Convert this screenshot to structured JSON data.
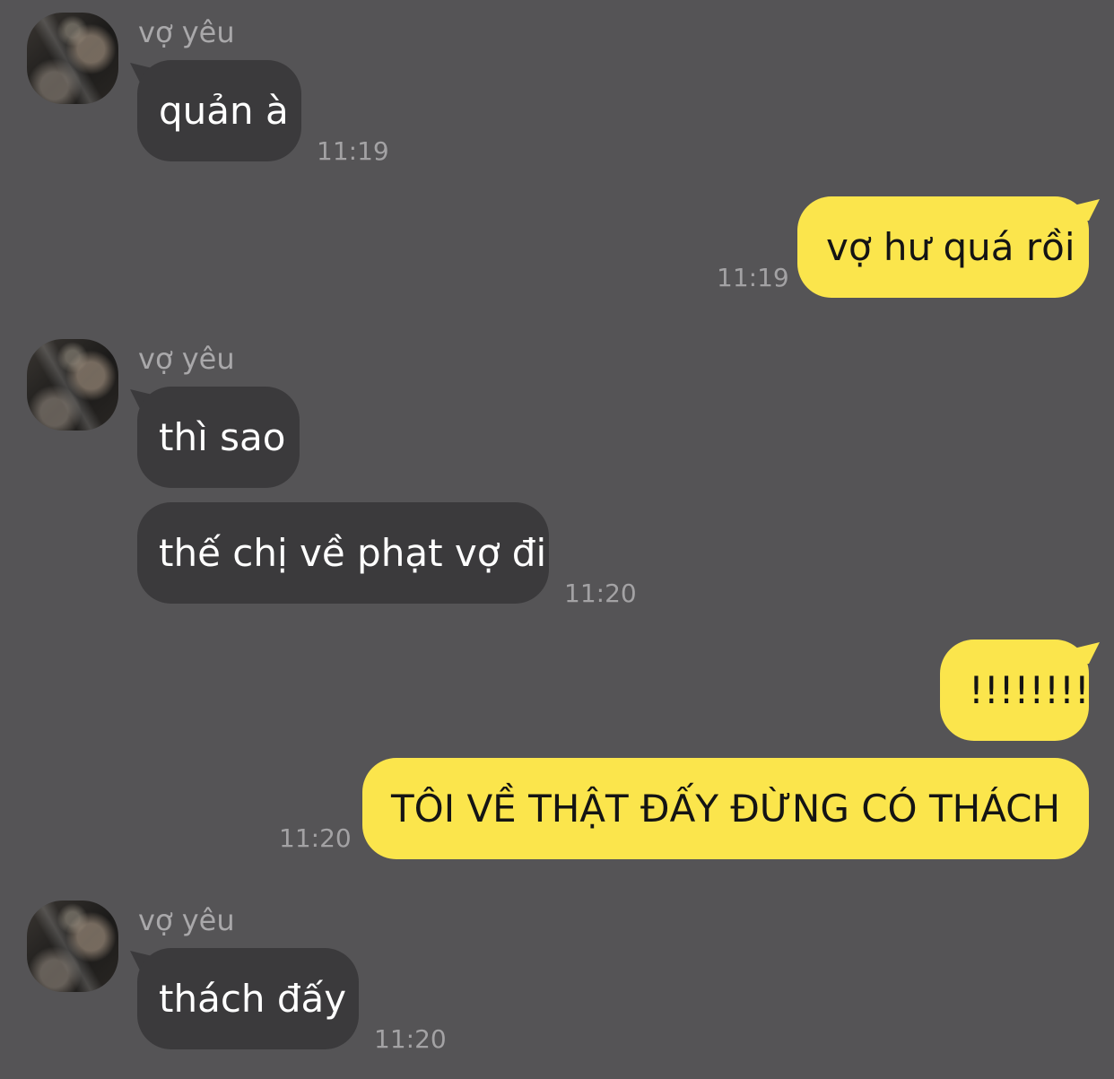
{
  "colors": {
    "background": "#555456",
    "incoming_bubble": "#3b3a3c",
    "outgoing_bubble": "#fbe54c",
    "timestamp": "#a3a2a4"
  },
  "messages": [
    {
      "sender": "vợ yêu",
      "text": "quản à",
      "time": "11:19"
    },
    {
      "text": "vợ hư quá rồi",
      "time": "11:19"
    },
    {
      "sender": "vợ yêu",
      "text": "thì sao"
    },
    {
      "text": "thế chị về phạt vợ đi",
      "time": "11:20"
    },
    {
      "text": "!!!!!!!!"
    },
    {
      "text": "TÔI VỀ THẬT ĐẤY ĐỪNG CÓ THÁCH",
      "time": "11:20"
    },
    {
      "sender": "vợ yêu",
      "text": "thách đấy",
      "time": "11:20"
    }
  ]
}
